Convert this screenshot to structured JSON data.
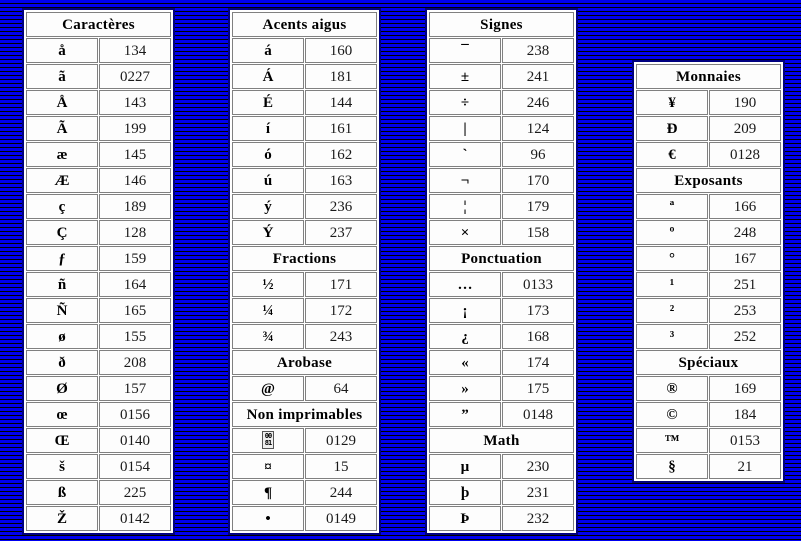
{
  "page": {
    "title": "Tableau des caractères spéciaux",
    "background_color": "#0000ee",
    "stripe_color": "#000000",
    "table_border_color": "#000080",
    "cell_border_color": "#808080"
  },
  "tables": [
    {
      "id": "t1",
      "name": "caracteres",
      "sections": [
        {
          "header": "Caractères",
          "rows": [
            {
              "glyph": "å",
              "code": "134"
            },
            {
              "glyph": "ã",
              "code": "0227"
            },
            {
              "glyph": "Å",
              "code": "143"
            },
            {
              "glyph": "Ã",
              "code": "199"
            },
            {
              "glyph": "æ",
              "code": "145"
            },
            {
              "glyph": "Æ",
              "code": "146"
            },
            {
              "glyph": "ç",
              "code": "189"
            },
            {
              "glyph": "Ç",
              "code": "128"
            },
            {
              "glyph": "ƒ",
              "code": "159"
            },
            {
              "glyph": "ñ",
              "code": "164"
            },
            {
              "glyph": "Ñ",
              "code": "165"
            },
            {
              "glyph": "ø",
              "code": "155"
            },
            {
              "glyph": "ð",
              "code": "208"
            },
            {
              "glyph": "Ø",
              "code": "157"
            },
            {
              "glyph": "œ",
              "code": "0156"
            },
            {
              "glyph": "Œ",
              "code": "0140"
            },
            {
              "glyph": "š",
              "code": "0154"
            },
            {
              "glyph": "ß",
              "code": "225"
            },
            {
              "glyph": "Ž",
              "code": "0142"
            }
          ]
        }
      ]
    },
    {
      "id": "t2",
      "name": "acents-aigus",
      "sections": [
        {
          "header": "Acents aigus",
          "rows": [
            {
              "glyph": "á",
              "code": "160"
            },
            {
              "glyph": "Á",
              "code": "181"
            },
            {
              "glyph": "É",
              "code": "144"
            },
            {
              "glyph": "í",
              "code": "161"
            },
            {
              "glyph": "ó",
              "code": "162"
            },
            {
              "glyph": "ú",
              "code": "163"
            },
            {
              "glyph": "ý",
              "code": "236"
            },
            {
              "glyph": "Ý",
              "code": "237"
            }
          ]
        },
        {
          "header": "Fractions",
          "rows": [
            {
              "glyph": "½",
              "code": "171"
            },
            {
              "glyph": "¼",
              "code": "172"
            },
            {
              "glyph": "¾",
              "code": "243"
            }
          ]
        },
        {
          "header": "Arobase",
          "rows": [
            {
              "glyph": "@",
              "code": "64"
            }
          ]
        },
        {
          "header": "Non imprimables",
          "rows": [
            {
              "glyph": "0081",
              "code": "0129",
              "style": "box"
            },
            {
              "glyph": "¤",
              "code": "15"
            },
            {
              "glyph": "¶",
              "code": "244"
            },
            {
              "glyph": "•",
              "code": "0149"
            }
          ]
        }
      ]
    },
    {
      "id": "t3",
      "name": "signes",
      "sections": [
        {
          "header": "Signes",
          "rows": [
            {
              "glyph": "¯",
              "code": "238"
            },
            {
              "glyph": "±",
              "code": "241"
            },
            {
              "glyph": "÷",
              "code": "246"
            },
            {
              "glyph": "|",
              "code": "124"
            },
            {
              "glyph": "`",
              "code": "96"
            },
            {
              "glyph": "¬",
              "code": "170"
            },
            {
              "glyph": "¦",
              "code": "179"
            },
            {
              "glyph": "×",
              "code": "158"
            }
          ]
        },
        {
          "header": "Ponctuation",
          "rows": [
            {
              "glyph": "…",
              "code": "0133"
            },
            {
              "glyph": "¡",
              "code": "173"
            },
            {
              "glyph": "¿",
              "code": "168"
            },
            {
              "glyph": "«",
              "code": "174"
            },
            {
              "glyph": "»",
              "code": "175"
            },
            {
              "glyph": "”",
              "code": "0148"
            }
          ]
        },
        {
          "header": "Math",
          "rows": [
            {
              "glyph": "µ",
              "code": "230"
            },
            {
              "glyph": "þ",
              "code": "231"
            },
            {
              "glyph": "Þ",
              "code": "232"
            }
          ]
        }
      ]
    },
    {
      "id": "t4",
      "name": "monnaies-exposants-speciaux",
      "sections": [
        {
          "header": "Monnaies",
          "rows": [
            {
              "glyph": "¥",
              "code": "190"
            },
            {
              "glyph": "Đ",
              "code": "209"
            },
            {
              "glyph": "€",
              "code": "0128"
            }
          ]
        },
        {
          "header": "Exposants",
          "rows": [
            {
              "glyph": "ª",
              "code": "166"
            },
            {
              "glyph": "º",
              "code": "248"
            },
            {
              "glyph": "°",
              "code": "167"
            },
            {
              "glyph": "¹",
              "code": "251"
            },
            {
              "glyph": "²",
              "code": "253"
            },
            {
              "glyph": "³",
              "code": "252"
            }
          ]
        },
        {
          "header": "Spéciaux",
          "rows": [
            {
              "glyph": "®",
              "code": "169"
            },
            {
              "glyph": "©",
              "code": "184"
            },
            {
              "glyph": "™",
              "code": "0153"
            },
            {
              "glyph": "§",
              "code": "21"
            }
          ]
        }
      ]
    }
  ]
}
